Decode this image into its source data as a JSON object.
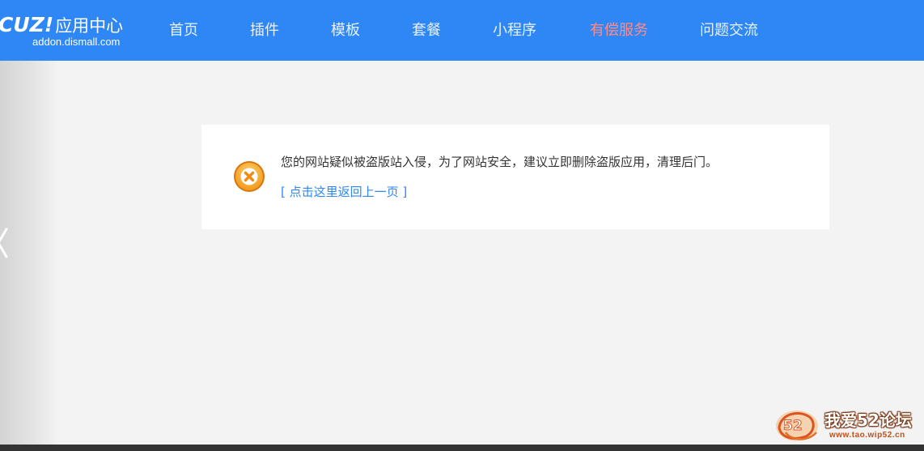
{
  "header": {
    "logo_brand": "CUZ!",
    "logo_title": "应用中心",
    "logo_domain": "addon.dismall.com",
    "bg_color": "#2e87f5",
    "nav": [
      {
        "label": "首页"
      },
      {
        "label": "插件"
      },
      {
        "label": "模板"
      },
      {
        "label": "套餐"
      },
      {
        "label": "小程序"
      },
      {
        "label": "有偿服务",
        "highlight": true
      },
      {
        "label": "问题交流"
      }
    ]
  },
  "message": {
    "icon": "error-circle-icon",
    "text": "您的网站疑似被盗版站入侵，为了网站安全，建议立即删除盗版应用，清理后门。",
    "back_link": "[ 点击这里返回上一页 ]",
    "link_color": "#2e87f5"
  },
  "watermark": {
    "title": "我爱52论坛",
    "url": "www.tao.wip52.cn",
    "logo_text": "52"
  }
}
